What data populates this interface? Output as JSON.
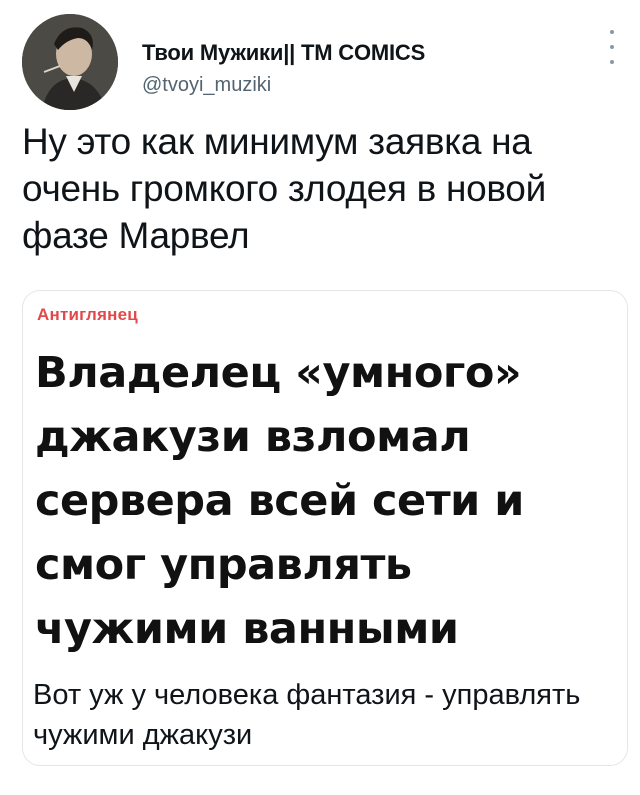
{
  "tweet": {
    "author": {
      "display_name": "Твои Мужики|| TM COMICS",
      "handle": "@tvoyi_muziki",
      "avatar_icon": "avatar-photo"
    },
    "more_icon": "vertical-ellipsis-icon",
    "text": "Ну это как минимум заявка на\nочень громкого злодея в новой\nфазе Марвел",
    "card": {
      "source": "Антиглянец",
      "headline": "Владелец «умного» джакузи взломал сервера всей сети и смог управлять чужими ванными",
      "caption": "Вот уж у человека фантазия - управлять чужими джакузи"
    }
  },
  "colors": {
    "text": "#0f1419",
    "secondary_text": "#536471",
    "source_red": "#e3494b",
    "border": "#e6e6e6"
  }
}
